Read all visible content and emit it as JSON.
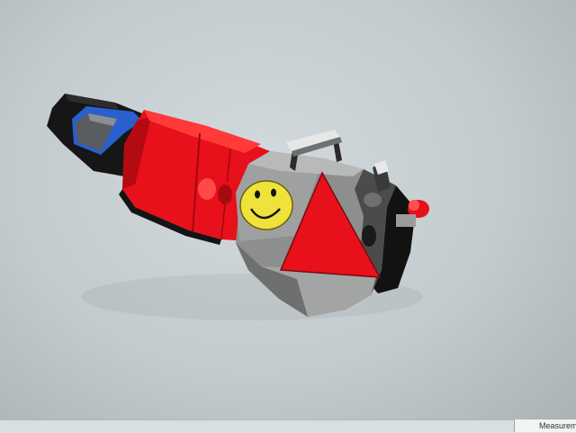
{
  "statusbar": {
    "measurements_label": "Measureme"
  },
  "colors": {
    "viewport_background": "#c9d0d3",
    "body_red": "#e8101a",
    "head_gray": "#8a8c8c",
    "face_yellow": "#efe23a",
    "accent_blue": "#2a5fd0",
    "dark": "#141414"
  },
  "icons": [
    "smiley-face-icon"
  ]
}
